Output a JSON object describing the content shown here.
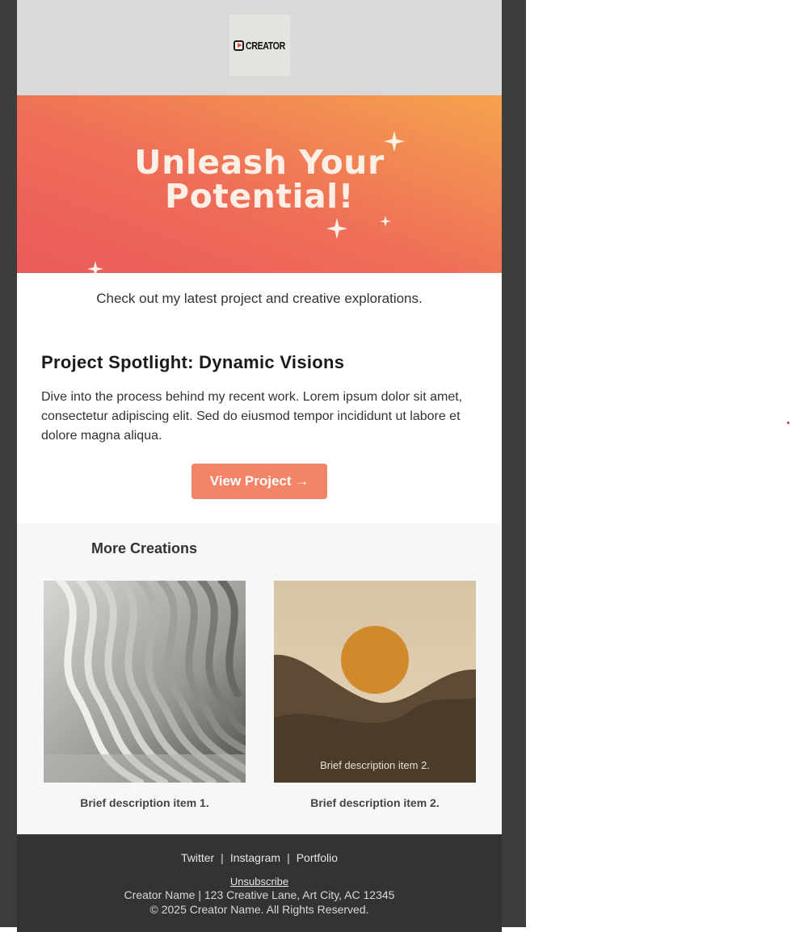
{
  "header": {
    "logo_text": "CREATOR"
  },
  "hero": {
    "title_line1": "Unleash Your",
    "title_line2": "Potential!"
  },
  "tagline": "Check out my latest project and creative explorations.",
  "spotlight": {
    "title": "Project Spotlight: Dynamic Visions",
    "body": "Dive into the process behind my recent work. Lorem ipsum dolor sit amet, consectetur adipiscing elit. Sed do eiusmod tempor incididunt ut labore et dolore magna aliqua.",
    "button_label": "View Project →"
  },
  "more": {
    "title": "More Creations",
    "items": [
      {
        "caption": "Brief description item 1.",
        "image": "abstract-wave-architecture"
      },
      {
        "caption": "Brief description item 2.",
        "image": "sunset-dunes-illustration",
        "image_overlay_text": "Brief description item 2."
      }
    ]
  },
  "footer": {
    "links": [
      "Twitter",
      "Instagram",
      "Portfolio"
    ],
    "separator": "|",
    "unsubscribe": "Unsubscribe",
    "address": "Creator Name | 123 Creative Lane, Art City, AC 12345",
    "copyright": "© 2025 Creator Name. All Rights Reserved."
  },
  "colors": {
    "hero_start": "#ea5a5a",
    "hero_end": "#f5a34e",
    "button": "#f38468",
    "footer_bg": "#333333",
    "frame_bg": "#3d3d3b"
  }
}
